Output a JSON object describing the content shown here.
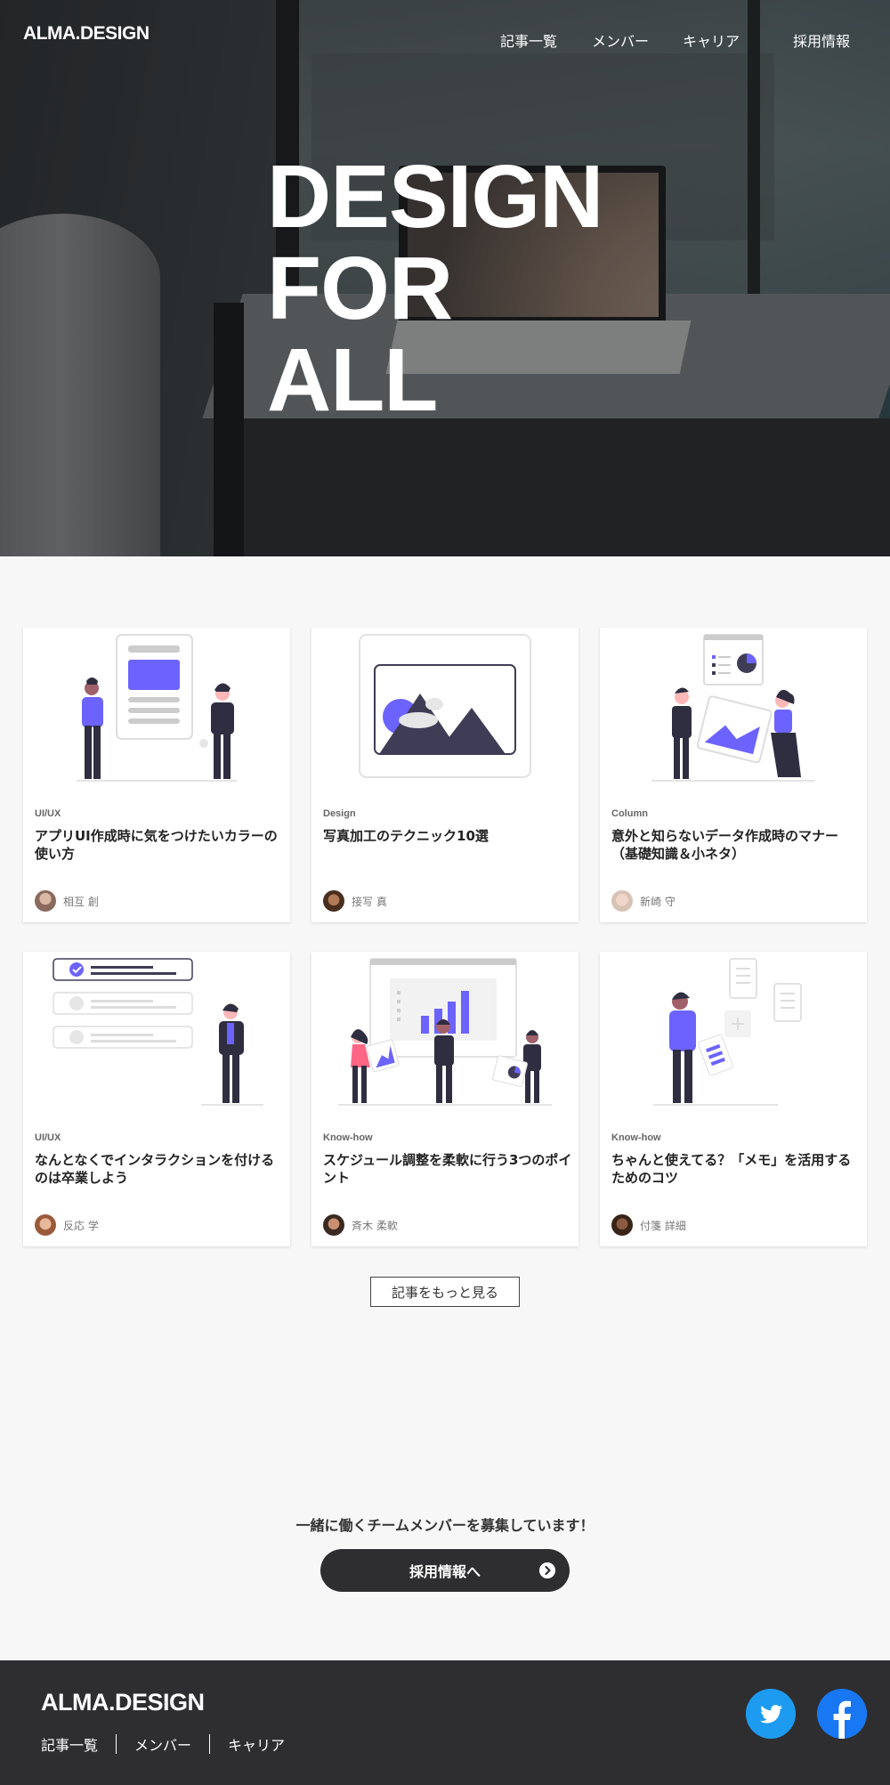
{
  "header": {
    "logo": "ALMA.DESIGN",
    "nav": [
      "記事一覧",
      "メンバー",
      "キャリア",
      "採用情報"
    ]
  },
  "hero": {
    "title_lines": [
      "DESIGN",
      "FOR",
      "ALL"
    ]
  },
  "articles": [
    {
      "category": "UI/UX",
      "title": "アプリUI作成時に気をつけたいカラーの使い方",
      "author": "相互 創",
      "illustration": "wireframe-people-illustration"
    },
    {
      "category": "Design",
      "title": "写真加工のテクニック10選",
      "author": "接写 真",
      "illustration": "image-placeholder-illustration"
    },
    {
      "category": "Column",
      "title": "意外と知らないデータ作成時のマナー（基礎知識＆小ネタ）",
      "author": "新崎 守",
      "illustration": "data-presentation-illustration"
    },
    {
      "category": "UI/UX",
      "title": "なんとなくでインタラクションを付けるのは卒業しよう",
      "author": "反応 学",
      "illustration": "checklist-person-illustration"
    },
    {
      "category": "Know-how",
      "title": "スケジュール調整を柔軟に行う3つのポイント",
      "author": "斉木 柔軟",
      "illustration": "team-chart-illustration"
    },
    {
      "category": "Know-how",
      "title": "ちゃんと使えてる？「メモ」を活用するためのコツ",
      "author": "付箋 詳細",
      "illustration": "notes-person-illustration"
    }
  ],
  "more_button": "記事をもっと見る",
  "recruit": {
    "message": "一緒に働くチームメンバーを募集しています！",
    "button": "採用情報へ"
  },
  "footer": {
    "logo": "ALMA.DESIGN",
    "nav": [
      "記事一覧",
      "メンバー",
      "キャリア"
    ],
    "social": [
      "twitter-icon",
      "facebook-icon"
    ]
  },
  "colors": {
    "accent": "#6c63ff",
    "dark": "#2e2e30",
    "figure": "#2f2e41",
    "twitter": "#1d9bf0",
    "facebook": "#1877f2"
  }
}
